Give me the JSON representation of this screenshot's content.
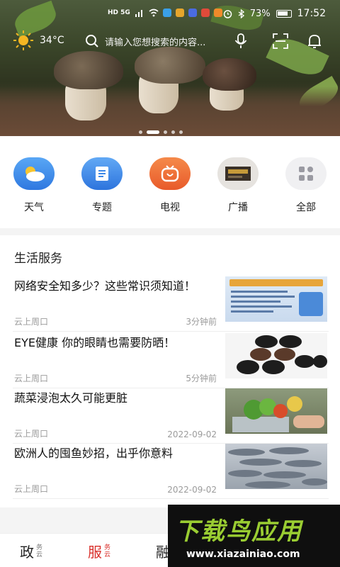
{
  "status_bar": {
    "left_tags": "HD 5G",
    "battery_percent": "73%",
    "time": "17:52"
  },
  "top_bar": {
    "temperature": "34°C",
    "search_placeholder": "请输入您想搜索的内容...",
    "icons": [
      "sun-icon",
      "search-icon",
      "mic-icon",
      "scan-icon",
      "bell-icon"
    ]
  },
  "banner": {
    "page_count": 5,
    "active_index": 0
  },
  "quick_nav": [
    {
      "label": "天气",
      "icon": "weather-icon",
      "color": "#3d8df0"
    },
    {
      "label": "专题",
      "icon": "topic-icon",
      "color": "#3d88e8"
    },
    {
      "label": "电视",
      "icon": "tv-icon",
      "color": "#f0683a"
    },
    {
      "label": "广播",
      "icon": "radio-icon",
      "color": "#d9d9d9"
    },
    {
      "label": "全部",
      "icon": "grid-icon",
      "color": "#f0f0f2"
    }
  ],
  "life_service": {
    "title": "生活服务",
    "items": [
      {
        "title": "网络安全知多少？这些常识须知道！",
        "source": "云上周口",
        "time": "3分钟前"
      },
      {
        "title": "EYE健康 你的眼睛也需要防晒！",
        "source": "云上周口",
        "time": "5分钟前"
      },
      {
        "title": "蔬菜浸泡太久可能更脏",
        "source": "云上周口",
        "time": "2022-09-02"
      },
      {
        "title": "欧洲人的囤鱼妙招，出乎你意料",
        "source": "云上周口",
        "time": "2022-09-02"
      }
    ]
  },
  "tab_bar": {
    "tabs": [
      {
        "big": "政",
        "small": "务云"
      },
      {
        "big": "服",
        "small": "务云",
        "active": true
      },
      {
        "big": "融",
        "small": ""
      }
    ],
    "active_color": "#d9302b"
  },
  "watermark": {
    "title": "下载鸟应用",
    "url": "www.xiazainiao.com"
  }
}
